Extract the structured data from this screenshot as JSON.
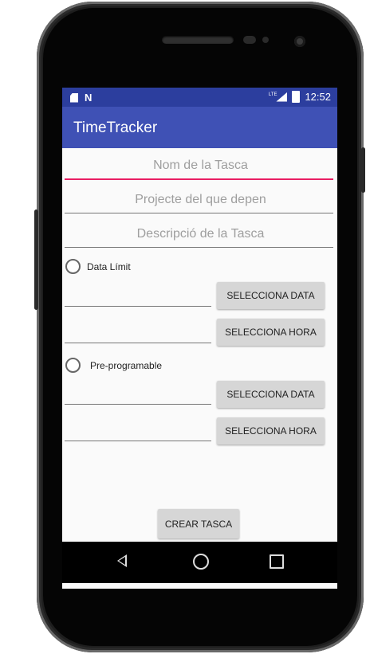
{
  "status_bar": {
    "time": "12:52",
    "network": "LTE"
  },
  "app_bar": {
    "title": "TimeTracker"
  },
  "form": {
    "task_name_placeholder": "Nom de la Tasca",
    "project_placeholder": "Projecte del que depen",
    "description_placeholder": "Descripció de la Tasca",
    "deadline_radio_label": "Data Límit",
    "preprogram_radio_label": "Pre-programable",
    "select_date_label": "SELECCIONA DATA",
    "select_time_label": "SELECCIONA HORA",
    "create_button_label": "CREAR TASCA"
  },
  "colors": {
    "primary": "#3f51b5",
    "primary_dark": "#2c3e9e",
    "accent": "#e91e63"
  }
}
